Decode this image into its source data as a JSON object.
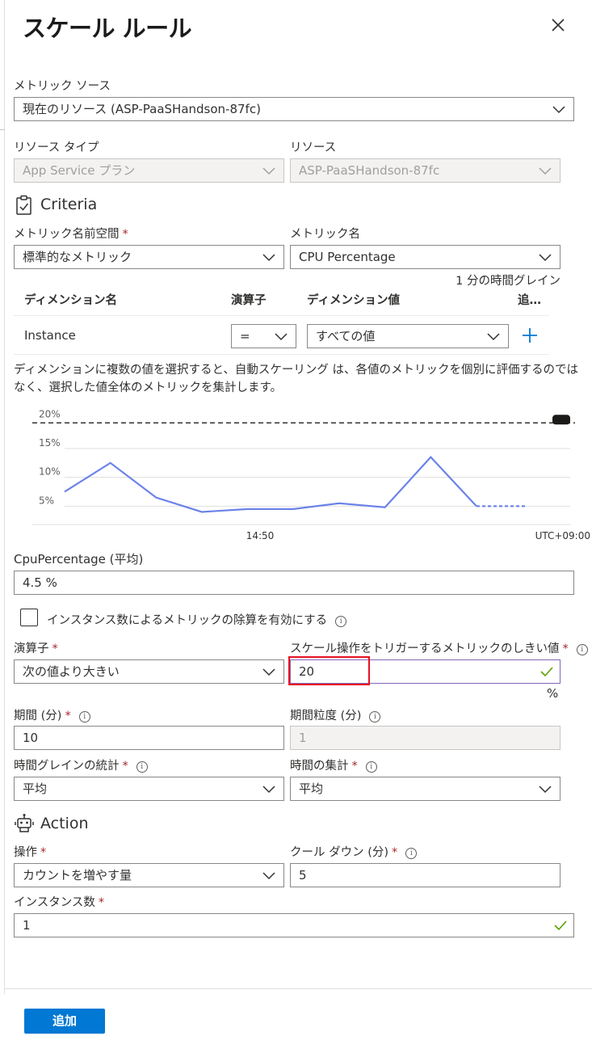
{
  "header": {
    "title": "スケール ルール",
    "close_icon": "close-icon"
  },
  "metric_source": {
    "label": "メトリック ソース",
    "value": "現在のリソース (ASP-PaaSHandson-87fc)"
  },
  "resource_type": {
    "label": "リソース タイプ",
    "value": "App Service プラン"
  },
  "resource": {
    "label": "リソース",
    "value": "ASP-PaaSHandson-87fc"
  },
  "criteria": {
    "title": "Criteria",
    "icon": "clipboard-check-icon",
    "namespace_label": "メトリック名前空間",
    "namespace_value": "標準的なメトリック",
    "metric_name_label": "メトリック名",
    "metric_name_value": "CPU Percentage",
    "time_grain_note": "1 分の時間グレイン"
  },
  "dimension_table": {
    "headers": {
      "name": "ディメンション名",
      "operator": "演算子",
      "value": "ディメンション値",
      "add": "追…"
    },
    "row": {
      "name": "Instance",
      "operator": "=",
      "value": "すべての値"
    }
  },
  "help_text": "ディメンションに複数の値を選択すると、自動スケーリング は、各値のメトリックを個別に評価するのではなく、選択した値全体のメトリックを集計します。",
  "chart_data": {
    "type": "line",
    "y_tick_labels": [
      "20%",
      "15%",
      "10%",
      "5%"
    ],
    "x_tick_labels": [
      "14:50"
    ],
    "timezone_label": "UTC+09:00",
    "threshold": 20,
    "ylim": [
      0,
      22
    ],
    "series": [
      {
        "values": [
          7.5,
          12.5,
          6.5,
          4.0,
          4.5,
          4.5,
          5.5,
          4.8,
          13.5,
          5.0
        ],
        "color": "#6b83e8"
      }
    ],
    "projected_tail": [
      5.0,
      5.0
    ],
    "grid": true
  },
  "metric_value": {
    "label": "CpuPercentage (平均)",
    "value": "4.5 %"
  },
  "divide_checkbox": {
    "label": "インスタンス数によるメトリックの除算を有効にする",
    "checked": false
  },
  "operator": {
    "label": "演算子",
    "value": "次の値より大きい"
  },
  "threshold": {
    "label": "スケール操作をトリガーするメトリックのしきい値",
    "value": "20",
    "unit": "%"
  },
  "duration": {
    "label": "期間 (分)",
    "value": "10"
  },
  "time_grain": {
    "label": "期間粒度 (分)",
    "value": "1"
  },
  "time_grain_stat": {
    "label": "時間グレインの統計",
    "value": "平均"
  },
  "time_aggregation": {
    "label": "時間の集計",
    "value": "平均"
  },
  "action": {
    "title": "Action",
    "icon": "robot-icon"
  },
  "operation": {
    "label": "操作",
    "value": "カウントを増やす量"
  },
  "cooldown": {
    "label": "クール ダウン (分)",
    "value": "5"
  },
  "instance_count": {
    "label": "インスタンス数",
    "value": "1"
  },
  "footer": {
    "add_button": "追加"
  },
  "colors": {
    "accent": "#0078d4",
    "required": "#a4262c",
    "valid": "#57a300",
    "highlight": "#e81123"
  }
}
